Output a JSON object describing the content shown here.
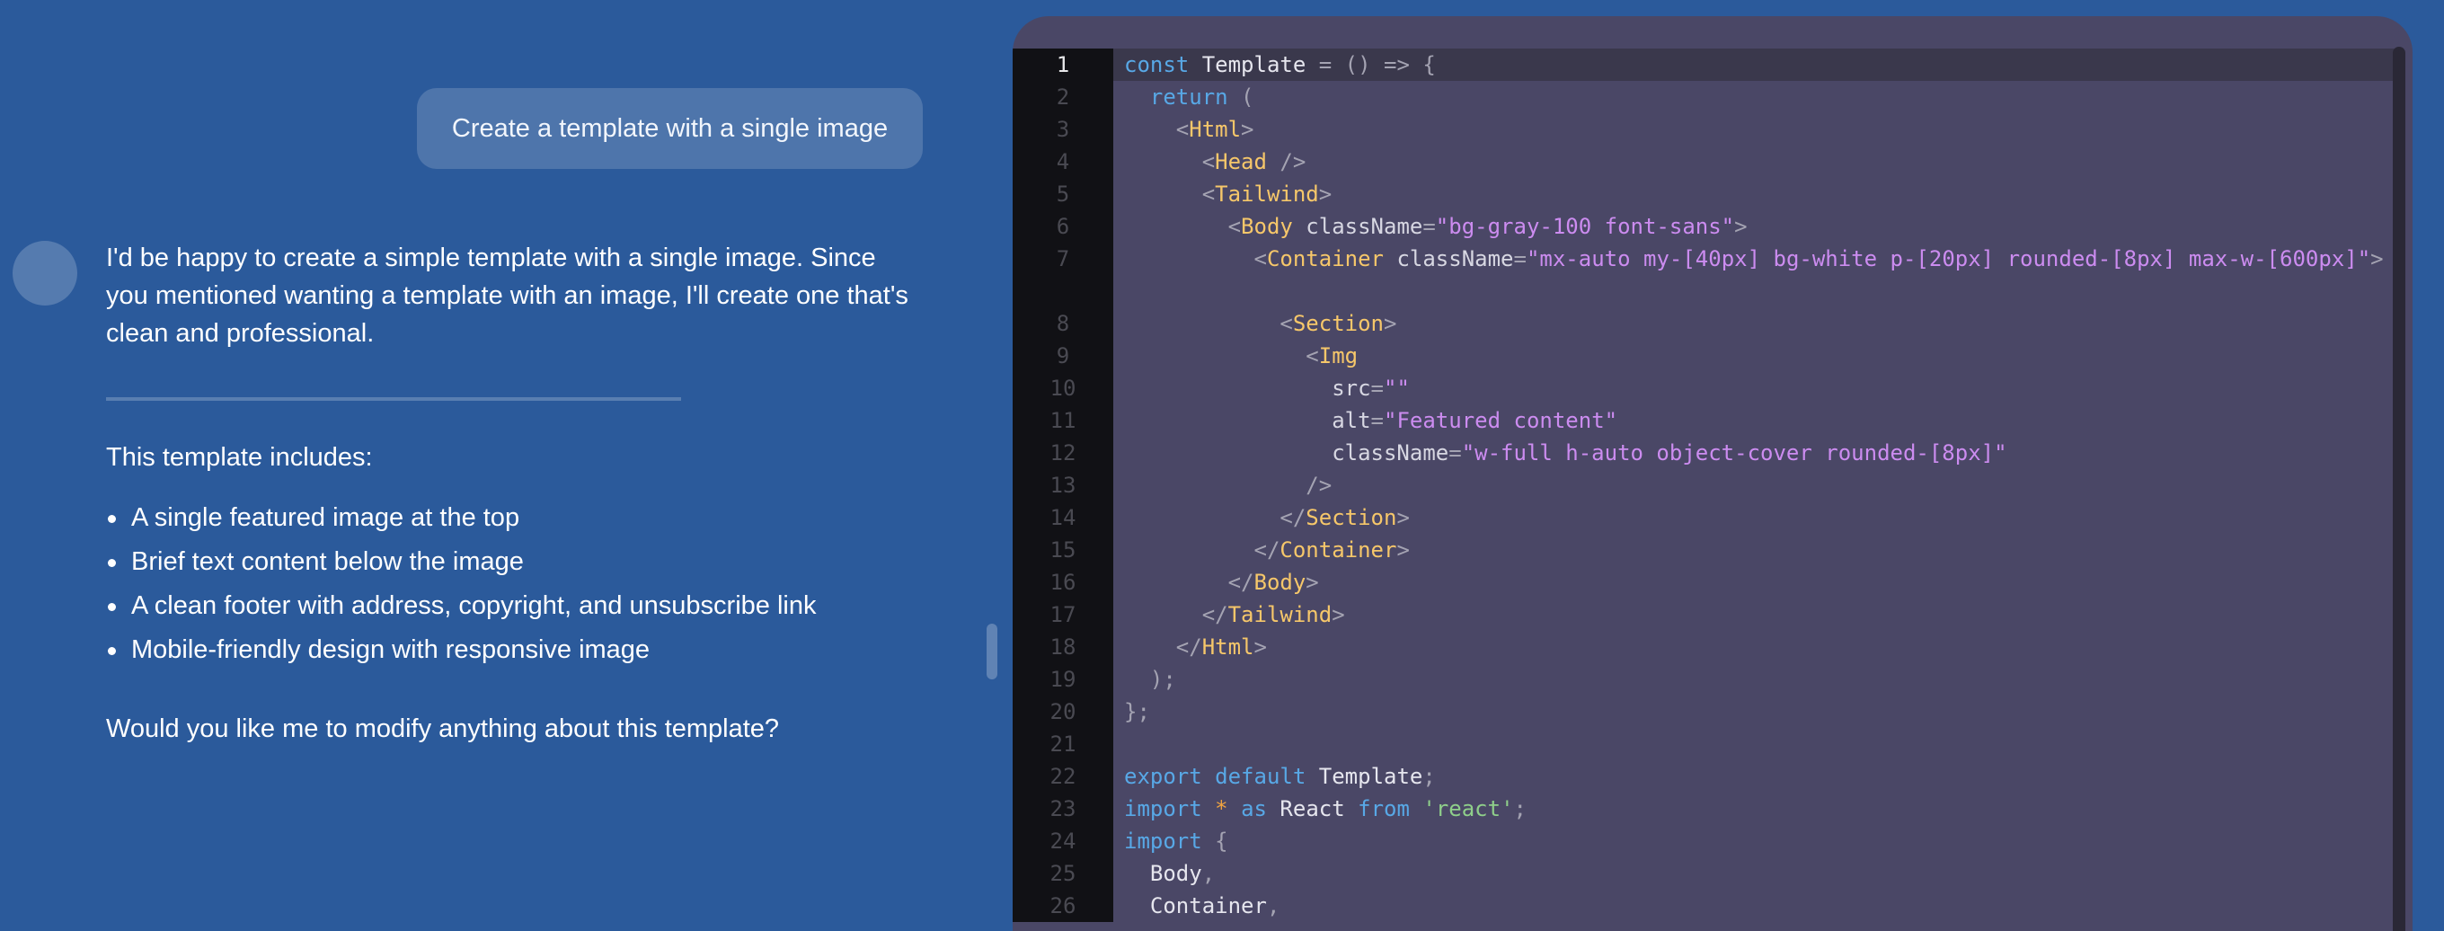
{
  "chat": {
    "user_message": "Create a template with a single image",
    "assistant_intro": "I'd be happy to create a simple template with a single image. Since you mentioned wanting a template with an image, I'll create one that's clean and professional.",
    "includes_heading": "This template includes:",
    "features": [
      "A single featured image at the top",
      "Brief text content below the image",
      "A clean footer with address, copyright, and unsubscribe link",
      "Mobile-friendly design with responsive image"
    ],
    "closing_question": "Would you like me to modify anything about this template?"
  },
  "editor": {
    "current_line": 1,
    "line_numbers": [
      "1",
      "2",
      "3",
      "4",
      "5",
      "6",
      "7",
      "8",
      "9",
      "10",
      "11",
      "12",
      "13",
      "14",
      "15",
      "16",
      "17",
      "18",
      "19",
      "20",
      "21",
      "22",
      "23",
      "24",
      "25",
      "26"
    ],
    "code": {
      "l1": [
        "const",
        " ",
        "Template",
        " = () => {"
      ],
      "l2": [
        "return",
        " ("
      ],
      "l3": [
        "<",
        "Html",
        ">"
      ],
      "l4": [
        "<",
        "Head",
        " />"
      ],
      "l5": [
        "<",
        "Tailwind",
        ">"
      ],
      "l6": [
        "<",
        "Body",
        " className",
        "=",
        "\"bg-gray-100 font-sans\"",
        ">"
      ],
      "l7": [
        "<",
        "Container",
        " className",
        "=",
        "\"mx-auto my-[40px] bg-white p-[20px] rounded-[8px] max-w-[600px]\"",
        ">"
      ],
      "l8": [
        "<",
        "Section",
        ">"
      ],
      "l9": [
        "<",
        "Img"
      ],
      "l10": [
        "src",
        "=",
        "\"\""
      ],
      "l11": [
        "alt",
        "=",
        "\"Featured content\""
      ],
      "l12": [
        "className",
        "=",
        "\"w-full h-auto object-cover rounded-[8px]\""
      ],
      "l13": [
        "/>"
      ],
      "l14": [
        "</",
        "Section",
        ">"
      ],
      "l15": [
        "</",
        "Container",
        ">"
      ],
      "l16": [
        "</",
        "Body",
        ">"
      ],
      "l17": [
        "</",
        "Tailwind",
        ">"
      ],
      "l18": [
        "</",
        "Html",
        ">"
      ],
      "l19": [
        ");"
      ],
      "l20": [
        "};"
      ],
      "l21": [
        ""
      ],
      "l22": [
        "export",
        " ",
        "default",
        " ",
        "Template",
        ";"
      ],
      "l23": [
        "import",
        " ",
        "*",
        " ",
        "as",
        " ",
        "React",
        " ",
        "from",
        " ",
        "'react'",
        ";"
      ],
      "l24": [
        "import",
        " {"
      ],
      "l25": [
        "Body",
        ","
      ],
      "l26": [
        "Container",
        ","
      ]
    }
  },
  "colors": {
    "background": "#2b5a9b",
    "editor_background": "#4a4766",
    "gutter_background": "#111115",
    "keyword": "#58a8e6",
    "tag": "#f6c76a",
    "string": "#cc8cf0"
  }
}
